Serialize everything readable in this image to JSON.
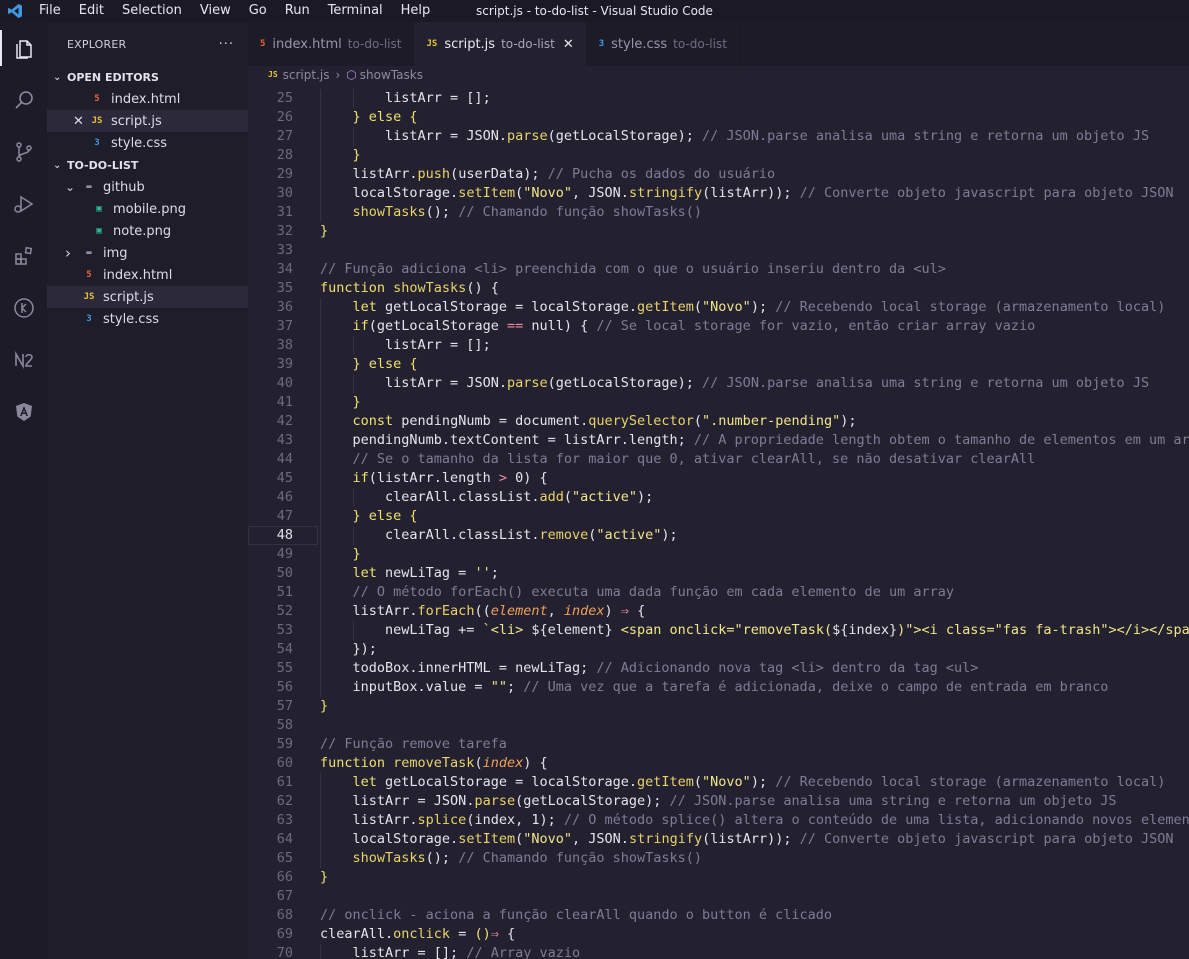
{
  "titlebar": {
    "menu": [
      "File",
      "Edit",
      "Selection",
      "View",
      "Go",
      "Run",
      "Terminal",
      "Help"
    ],
    "window_title": "script.js - to-do-list - Visual Studio Code"
  },
  "activity_icons": [
    "files-icon",
    "search-icon",
    "source-control-icon",
    "run-debug-icon",
    "extensions-icon",
    "remote-icon",
    "n2-icon",
    "angular-icon"
  ],
  "sidebar": {
    "title": "EXPLORER",
    "more": "···",
    "open_editors_label": "OPEN EDITORS",
    "open_editors": [
      {
        "name": "index.html",
        "type": "html"
      },
      {
        "name": "script.js",
        "type": "js",
        "selected": true
      },
      {
        "name": "style.css",
        "type": "css"
      }
    ],
    "folder_label": "TO-DO-LIST",
    "tree": [
      {
        "name": "github",
        "type": "folder",
        "open": true,
        "depth": 1
      },
      {
        "name": "mobile.png",
        "type": "image",
        "depth": 2
      },
      {
        "name": "note.png",
        "type": "image",
        "depth": 2
      },
      {
        "name": "img",
        "type": "folder",
        "open": false,
        "depth": 1
      },
      {
        "name": "index.html",
        "type": "html",
        "depth": 1
      },
      {
        "name": "script.js",
        "type": "js",
        "depth": 1,
        "selected": true
      },
      {
        "name": "style.css",
        "type": "css",
        "depth": 1
      }
    ]
  },
  "tabs": [
    {
      "name": "index.html",
      "dir": "to-do-list",
      "type": "html"
    },
    {
      "name": "script.js",
      "dir": "to-do-list",
      "type": "js",
      "active": true
    },
    {
      "name": "style.css",
      "dir": "to-do-list",
      "type": "css"
    }
  ],
  "breadcrumb": {
    "file": "script.js",
    "symbol": "showTasks"
  },
  "editor": {
    "current_line": 48,
    "lines": [
      {
        "n": 25,
        "i": 2,
        "t": [
          [
            "listArr = [];",
            "v"
          ]
        ]
      },
      {
        "n": 26,
        "i": 1,
        "t": [
          [
            "} else {",
            "k"
          ]
        ]
      },
      {
        "n": 27,
        "i": 2,
        "t": [
          [
            "listArr = ",
            "v"
          ],
          [
            "JSON",
            "c"
          ],
          [
            ".",
            ""
          ],
          [
            "parse",
            "f"
          ],
          [
            "(getLocalStorage); ",
            ""
          ],
          [
            "// JSON.parse analisa uma string e retorna um objeto JS",
            "m"
          ]
        ]
      },
      {
        "n": 28,
        "i": 1,
        "t": [
          [
            "}",
            "k"
          ]
        ]
      },
      {
        "n": 29,
        "i": 1,
        "t": [
          [
            "listArr.",
            ""
          ],
          [
            "push",
            "f"
          ],
          [
            "(userData); ",
            ""
          ],
          [
            "// Pucha os dados do usuário",
            "m"
          ]
        ]
      },
      {
        "n": 30,
        "i": 1,
        "t": [
          [
            "localStorage.",
            ""
          ],
          [
            "setItem",
            "f"
          ],
          [
            "(",
            ""
          ],
          [
            "\"Novo\"",
            "s"
          ],
          [
            ", ",
            ""
          ],
          [
            "JSON",
            "c"
          ],
          [
            ".",
            ""
          ],
          [
            "stringify",
            "f"
          ],
          [
            "(listArr)); ",
            ""
          ],
          [
            "// Converte objeto javascript para objeto JSON",
            "m"
          ]
        ]
      },
      {
        "n": 31,
        "i": 1,
        "t": [
          [
            "showTasks",
            "f"
          ],
          [
            "(); ",
            ""
          ],
          [
            "// Chamando função showTasks()",
            "m"
          ]
        ]
      },
      {
        "n": 32,
        "i": 0,
        "t": [
          [
            "}",
            "k"
          ]
        ]
      },
      {
        "n": 33,
        "i": 0,
        "t": []
      },
      {
        "n": 34,
        "i": 0,
        "t": [
          [
            "// Função adiciona <li> preenchida com o que o usuário inseriu dentro da <ul>",
            "m"
          ]
        ]
      },
      {
        "n": 35,
        "i": 0,
        "t": [
          [
            "function ",
            "k"
          ],
          [
            "showTasks",
            "f"
          ],
          [
            "() {",
            ""
          ]
        ]
      },
      {
        "n": 36,
        "i": 1,
        "t": [
          [
            "let ",
            "k"
          ],
          [
            "getLocalStorage = localStorage.",
            ""
          ],
          [
            "getItem",
            "f"
          ],
          [
            "(",
            ""
          ],
          [
            "\"Novo\"",
            "s"
          ],
          [
            "); ",
            ""
          ],
          [
            "// Recebendo local storage (armazenamento local)",
            "m"
          ]
        ]
      },
      {
        "n": 37,
        "i": 1,
        "t": [
          [
            "if",
            "k"
          ],
          [
            "(getLocalStorage ",
            ""
          ],
          [
            "==",
            "o"
          ],
          [
            " null) { ",
            ""
          ],
          [
            "// Se local storage for vazio, então criar array vazio",
            "m"
          ]
        ]
      },
      {
        "n": 38,
        "i": 2,
        "t": [
          [
            "listArr = [];",
            ""
          ]
        ]
      },
      {
        "n": 39,
        "i": 1,
        "t": [
          [
            "} else {",
            "k"
          ]
        ]
      },
      {
        "n": 40,
        "i": 2,
        "t": [
          [
            "listArr = ",
            ""
          ],
          [
            "JSON",
            "c"
          ],
          [
            ".",
            ""
          ],
          [
            "parse",
            "f"
          ],
          [
            "(getLocalStorage); ",
            ""
          ],
          [
            "// JSON.parse analisa uma string e retorna um objeto JS",
            "m"
          ]
        ]
      },
      {
        "n": 41,
        "i": 1,
        "t": [
          [
            "}",
            "k"
          ]
        ]
      },
      {
        "n": 42,
        "i": 1,
        "t": [
          [
            "const ",
            "k"
          ],
          [
            "pendingNumb = document.",
            ""
          ],
          [
            "querySelector",
            "f"
          ],
          [
            "(",
            ""
          ],
          [
            "\".number-pending\"",
            "s"
          ],
          [
            ");",
            ""
          ]
        ]
      },
      {
        "n": 43,
        "i": 1,
        "t": [
          [
            "pendingNumb.textContent = listArr.length; ",
            ""
          ],
          [
            "// A propriedade length obtem o tamanho de elementos em um array",
            "m"
          ]
        ]
      },
      {
        "n": 44,
        "i": 1,
        "t": [
          [
            "// Se o tamanho da lista for maior que 0, ativar clearAll, se não desativar clearAll",
            "m"
          ]
        ]
      },
      {
        "n": 45,
        "i": 1,
        "t": [
          [
            "if",
            "k"
          ],
          [
            "(listArr.length ",
            ""
          ],
          [
            ">",
            "o"
          ],
          [
            " 0) {",
            ""
          ]
        ]
      },
      {
        "n": 46,
        "i": 2,
        "t": [
          [
            "clearAll.classList.",
            ""
          ],
          [
            "add",
            "f"
          ],
          [
            "(",
            ""
          ],
          [
            "\"active\"",
            "s"
          ],
          [
            ");",
            ""
          ]
        ]
      },
      {
        "n": 47,
        "i": 1,
        "t": [
          [
            "} else {",
            "k"
          ]
        ]
      },
      {
        "n": 48,
        "i": 2,
        "t": [
          [
            "clearAll.classList.",
            ""
          ],
          [
            "remove",
            "f"
          ],
          [
            "(",
            ""
          ],
          [
            "\"active\"",
            "s"
          ],
          [
            ");",
            ""
          ]
        ]
      },
      {
        "n": 49,
        "i": 1,
        "t": [
          [
            "}",
            "k"
          ]
        ]
      },
      {
        "n": 50,
        "i": 1,
        "t": [
          [
            "let ",
            "k"
          ],
          [
            "newLiTag = ",
            ""
          ],
          [
            "''",
            "s"
          ],
          [
            ";",
            ""
          ]
        ]
      },
      {
        "n": 51,
        "i": 1,
        "t": [
          [
            "// O método forEach() executa uma dada função em cada elemento de um array",
            "m"
          ]
        ]
      },
      {
        "n": 52,
        "i": 1,
        "t": [
          [
            "listArr.",
            ""
          ],
          [
            "forEach",
            "f"
          ],
          [
            "((",
            ""
          ],
          [
            "element",
            "p"
          ],
          [
            ", ",
            ""
          ],
          [
            "index",
            "p"
          ],
          [
            ") ",
            ""
          ],
          [
            "⇒",
            "o"
          ],
          [
            " {",
            ""
          ]
        ]
      },
      {
        "n": 53,
        "i": 2,
        "t": [
          [
            "newLiTag += ",
            ""
          ],
          [
            "`<li> ",
            "s"
          ],
          [
            "${element}",
            ""
          ],
          [
            " <span onclick=\"removeTask(",
            "s"
          ],
          [
            "${index}",
            ""
          ],
          [
            ")\"><i class=\"fas fa-trash\"></i></span></li>`",
            "s"
          ]
        ]
      },
      {
        "n": 54,
        "i": 1,
        "t": [
          [
            "});",
            ""
          ]
        ]
      },
      {
        "n": 55,
        "i": 1,
        "t": [
          [
            "todoBox.innerHTML = newLiTag; ",
            ""
          ],
          [
            "// Adicionando nova tag <li> dentro da tag <ul>",
            "m"
          ]
        ]
      },
      {
        "n": 56,
        "i": 1,
        "t": [
          [
            "inputBox.value = ",
            ""
          ],
          [
            "\"\"",
            "s"
          ],
          [
            "; ",
            ""
          ],
          [
            "// Uma vez que a tarefa é adicionada, deixe o campo de entrada em branco",
            "m"
          ]
        ]
      },
      {
        "n": 57,
        "i": 0,
        "t": [
          [
            "}",
            "k"
          ]
        ]
      },
      {
        "n": 58,
        "i": 0,
        "t": []
      },
      {
        "n": 59,
        "i": 0,
        "t": [
          [
            "// Função remove tarefa",
            "m"
          ]
        ]
      },
      {
        "n": 60,
        "i": 0,
        "t": [
          [
            "function ",
            "k"
          ],
          [
            "removeTask",
            "f"
          ],
          [
            "(",
            ""
          ],
          [
            "index",
            "p"
          ],
          [
            ") {",
            ""
          ]
        ]
      },
      {
        "n": 61,
        "i": 1,
        "t": [
          [
            "let ",
            "k"
          ],
          [
            "getLocalStorage = localStorage.",
            ""
          ],
          [
            "getItem",
            "f"
          ],
          [
            "(",
            ""
          ],
          [
            "\"Novo\"",
            "s"
          ],
          [
            "); ",
            ""
          ],
          [
            "// Recebendo local storage (armazenamento local)",
            "m"
          ]
        ]
      },
      {
        "n": 62,
        "i": 1,
        "t": [
          [
            "listArr = ",
            ""
          ],
          [
            "JSON",
            "c"
          ],
          [
            ".",
            ""
          ],
          [
            "parse",
            "f"
          ],
          [
            "(getLocalStorage); ",
            ""
          ],
          [
            "// JSON.parse analisa uma string e retorna um objeto JS",
            "m"
          ]
        ]
      },
      {
        "n": 63,
        "i": 1,
        "t": [
          [
            "listArr.",
            ""
          ],
          [
            "splice",
            "f"
          ],
          [
            "(index, 1); ",
            ""
          ],
          [
            "// O método splice() altera o conteúdo de uma lista, adicionando novos elementos",
            "m"
          ]
        ]
      },
      {
        "n": 64,
        "i": 1,
        "t": [
          [
            "localStorage.",
            ""
          ],
          [
            "setItem",
            "f"
          ],
          [
            "(",
            ""
          ],
          [
            "\"Novo\"",
            "s"
          ],
          [
            ", ",
            ""
          ],
          [
            "JSON",
            "c"
          ],
          [
            ".",
            ""
          ],
          [
            "stringify",
            "f"
          ],
          [
            "(listArr)); ",
            ""
          ],
          [
            "// Converte objeto javascript para objeto JSON",
            "m"
          ]
        ]
      },
      {
        "n": 65,
        "i": 1,
        "t": [
          [
            "showTasks",
            "f"
          ],
          [
            "(); ",
            ""
          ],
          [
            "// Chamando função showTasks()",
            "m"
          ]
        ]
      },
      {
        "n": 66,
        "i": 0,
        "t": [
          [
            "}",
            "k"
          ]
        ]
      },
      {
        "n": 67,
        "i": 0,
        "t": []
      },
      {
        "n": 68,
        "i": 0,
        "t": [
          [
            "// onclick - aciona a função clearAll quando o button é clicado",
            "m"
          ]
        ]
      },
      {
        "n": 69,
        "i": 0,
        "t": [
          [
            "clearAll.",
            ""
          ],
          [
            "onclick",
            "f"
          ],
          [
            " = ",
            ""
          ],
          [
            "()",
            "k"
          ],
          [
            "⇒",
            "o"
          ],
          [
            " {",
            ""
          ]
        ]
      },
      {
        "n": 70,
        "i": 1,
        "t": [
          [
            "listArr = []; ",
            ""
          ],
          [
            "// Array vazio",
            "m"
          ]
        ]
      }
    ]
  },
  "colors": {
    "keyword": "#f0e070",
    "function": "#e8d36a",
    "comment": "#7e7c96",
    "string": "#f2e68a",
    "const": "#e4e4ee",
    "param": "#ef9f5a",
    "operator": "#ef8aa3"
  }
}
